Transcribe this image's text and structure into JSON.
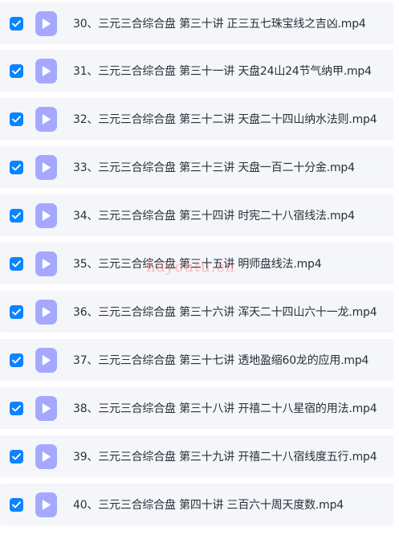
{
  "files": [
    {
      "name": "30、三元三合综合盘 第三十讲 正三五七珠宝线之吉凶.mp4",
      "checked": true,
      "icon": "video-file-icon"
    },
    {
      "name": "31、三元三合综合盘 第三十一讲 天盘24山24节气纳甲.mp4",
      "checked": true,
      "icon": "video-file-icon"
    },
    {
      "name": "32、三元三合综合盘 第三十二讲 天盘二十四山纳水法则.mp4",
      "checked": true,
      "icon": "video-file-icon"
    },
    {
      "name": "33、三元三合综合盘 第三十三讲 天盘一百二十分金.mp4",
      "checked": true,
      "icon": "video-file-icon"
    },
    {
      "name": "34、三元三合综合盘 第三十四讲 时宪二十八宿线法.mp4",
      "checked": true,
      "icon": "video-file-icon"
    },
    {
      "name": "35、三元三合综合盘 第三十五讲 明师盘线法.mp4",
      "checked": true,
      "icon": "video-file-icon"
    },
    {
      "name": "36、三元三合综合盘 第三十六讲 浑天二十四山六十一龙.mp4",
      "checked": true,
      "icon": "video-file-icon"
    },
    {
      "name": "37、三元三合综合盘 第三十七讲 透地盈缩60龙的应用.mp4",
      "checked": true,
      "icon": "video-file-icon"
    },
    {
      "name": "38、三元三合综合盘 第三十八讲 开禧二十八星宿的用法.mp4",
      "checked": true,
      "icon": "video-file-icon"
    },
    {
      "name": "39、三元三合综合盘 第三十九讲 开禧二十八宿线度五行.mp4",
      "checked": true,
      "icon": "video-file-icon"
    },
    {
      "name": "40、三元三合综合盘 第四十讲 三百六十周天度数.mp4",
      "checked": true,
      "icon": "video-file-icon"
    }
  ],
  "watermark": "hayoutu.cn",
  "colors": {
    "checkbox": "#0a84ff",
    "file_icon": "#a4a9ff",
    "row_background": "#f5f6fa",
    "text": "#2b2f3a"
  }
}
